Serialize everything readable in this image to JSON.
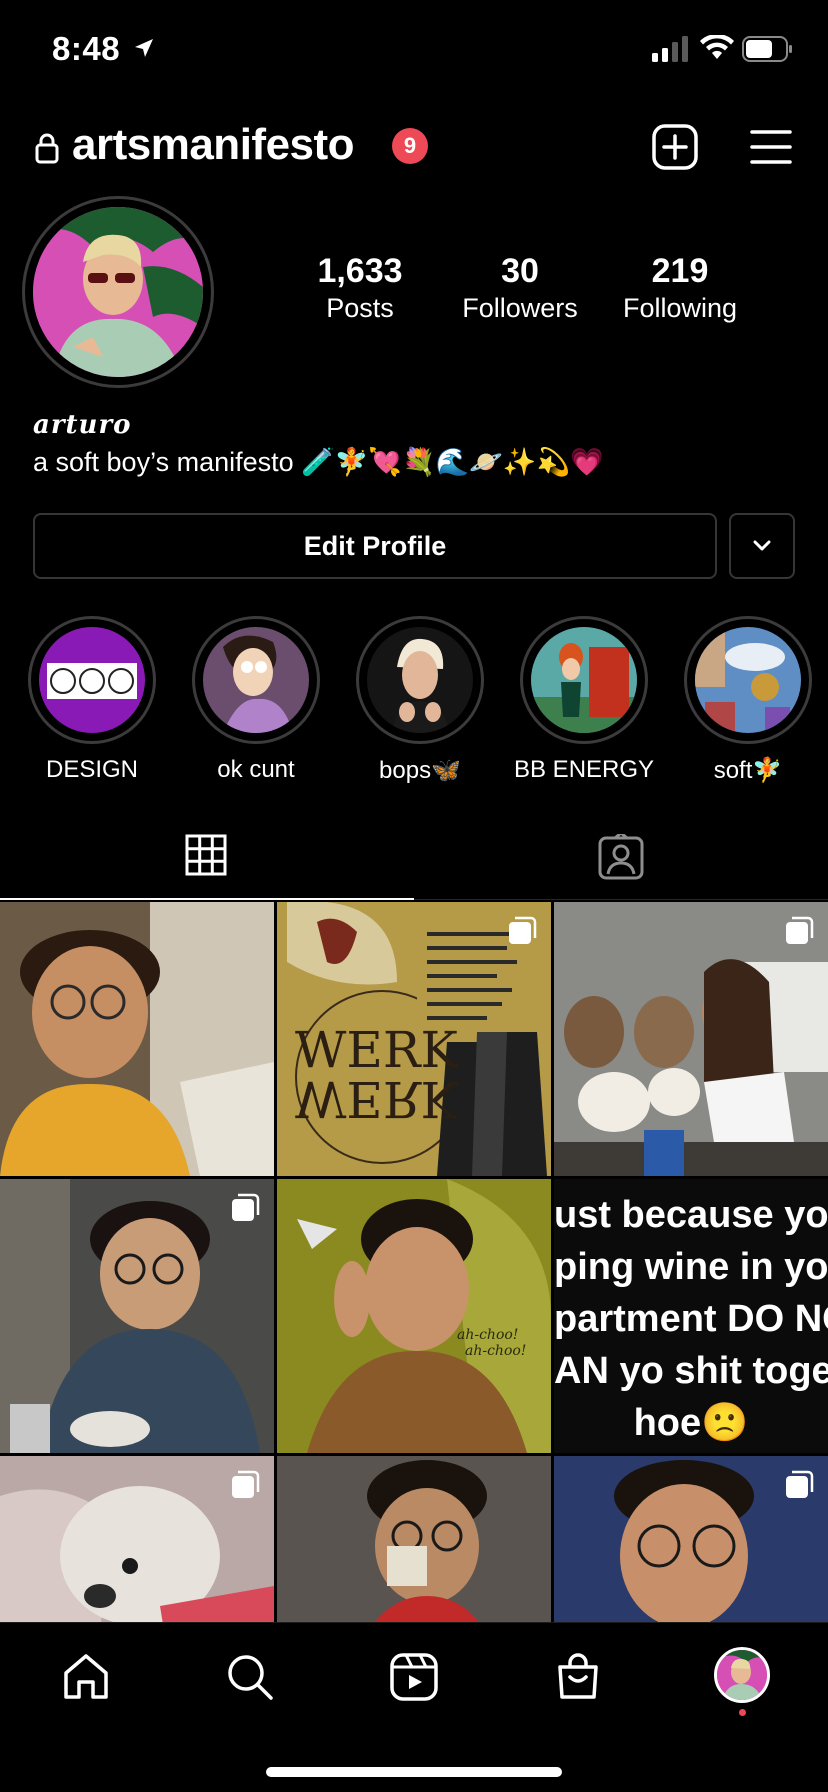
{
  "status_bar": {
    "time": "8:48"
  },
  "header": {
    "username": "artsmanifesto",
    "notification_count": "9"
  },
  "profile": {
    "posts": {
      "count": "1,633",
      "label": "Posts"
    },
    "followers": {
      "count": "30",
      "label": "Followers"
    },
    "following": {
      "count": "219",
      "label": "Following"
    },
    "name": "arturo",
    "bio": "a soft boy’s manifesto 🧪🧚💘💐🌊🪐✨💫💗"
  },
  "actions": {
    "edit_profile": "Edit Profile"
  },
  "highlights": [
    {
      "label": "DESIGN"
    },
    {
      "label": "ok cunt"
    },
    {
      "label": "bops🦋"
    },
    {
      "label": "BB ENERGY"
    },
    {
      "label": "soft🧚"
    }
  ],
  "text_post": {
    "lines": [
      "ust because yo",
      "ping wine in yo",
      "partment DO NO",
      "AN yo shit toge",
      "hoe🙁"
    ]
  },
  "colors": {
    "badge": "#ed4956",
    "background": "#000000",
    "border": "#363636"
  },
  "icons": {
    "tabs": [
      "grid-icon",
      "tagged-icon"
    ],
    "nav": [
      "home-icon",
      "search-icon",
      "reels-icon",
      "shop-icon",
      "profile-avatar"
    ]
  }
}
